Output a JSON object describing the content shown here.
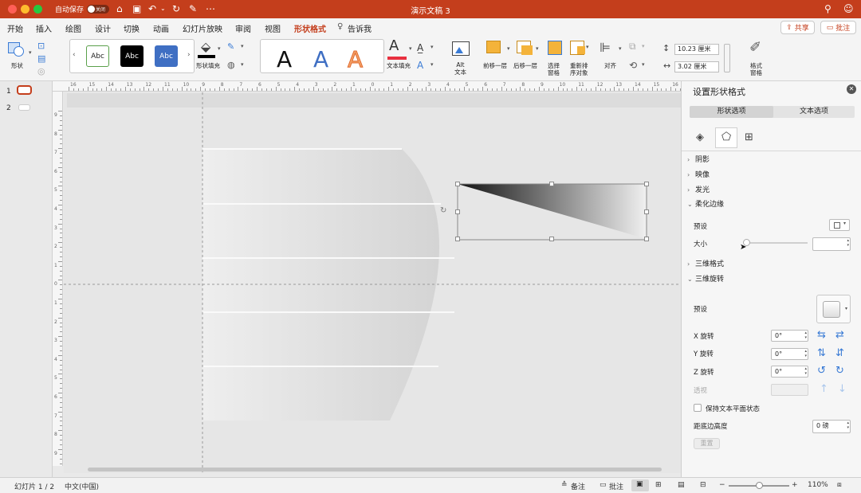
{
  "window": {
    "title": "演示文稿 3",
    "autosave_label": "自动保存",
    "autosave_state": "关闭"
  },
  "tabs": [
    "开始",
    "插入",
    "绘图",
    "设计",
    "切换",
    "动画",
    "幻灯片放映",
    "审阅",
    "视图",
    "形状格式",
    "告诉我"
  ],
  "active_tab": "形状格式",
  "top_buttons": {
    "share": "共享",
    "comments": "批注"
  },
  "ribbon": {
    "shape_label": "形状",
    "style_labels": [
      "Abc",
      "Abc",
      "Abc"
    ],
    "shape_fill_label": "形状填充",
    "wordart_letter": "A",
    "text_fill_label": "文本填充",
    "alt_text_label": "Alt\n文本",
    "bring_forward": "前移一层",
    "send_backward": "后移一层",
    "selection_pane": "选择\n窗格",
    "reorder": "重新排\n序对象",
    "align": "对齐",
    "height": "10.23 厘米",
    "width": "3.02 厘米",
    "format_pane": "格式\n窗格"
  },
  "thumbnails": [
    "1",
    "2"
  ],
  "ruler_h_labels": [
    "16",
    "15",
    "14",
    "13",
    "12",
    "11",
    "10",
    "9",
    "8",
    "7",
    "6",
    "5",
    "4",
    "3",
    "2",
    "1",
    "0",
    "1",
    "2",
    "3",
    "4",
    "5",
    "6",
    "7",
    "8",
    "9",
    "10",
    "11",
    "12",
    "13",
    "14",
    "15",
    "16"
  ],
  "ruler_v_labels": [
    "9",
    "8",
    "7",
    "6",
    "5",
    "4",
    "3",
    "2",
    "1",
    "0",
    "1",
    "2",
    "3",
    "4",
    "5",
    "6",
    "7",
    "8",
    "9"
  ],
  "panel": {
    "title": "设置形状格式",
    "tab_shape": "形状选项",
    "tab_text": "文本选项",
    "sections": {
      "shadow": "阴影",
      "reflection": "映像",
      "glow": "发光",
      "soft_edges": "柔化边缘",
      "format_3d": "三维格式",
      "rotation_3d": "三维旋转"
    },
    "soft_edges_preset_label": "预设",
    "soft_edges_size_label": "大小",
    "soft_edges_size_value": "",
    "rotation_preset_label": "预设",
    "x_rotation_label": "X 旋转",
    "x_rotation_value": "0°",
    "y_rotation_label": "Y 旋转",
    "y_rotation_value": "0°",
    "z_rotation_label": "Z 旋转",
    "z_rotation_value": "0°",
    "perspective_label": "透视",
    "perspective_value": "",
    "keep_text_flat_label": "保持文本平面状态",
    "distance_label": "距底边高度",
    "distance_value": "0 磅",
    "reset_label": "重置"
  },
  "status": {
    "slide": "幻灯片 1 / 2",
    "language": "中文(中国)",
    "notes": "备注",
    "comments": "批注",
    "zoom": "110%"
  },
  "colors": {
    "accent": "#c43e1c",
    "selection_fill": "#e8303f",
    "style_blue": "#3f6fc3"
  }
}
